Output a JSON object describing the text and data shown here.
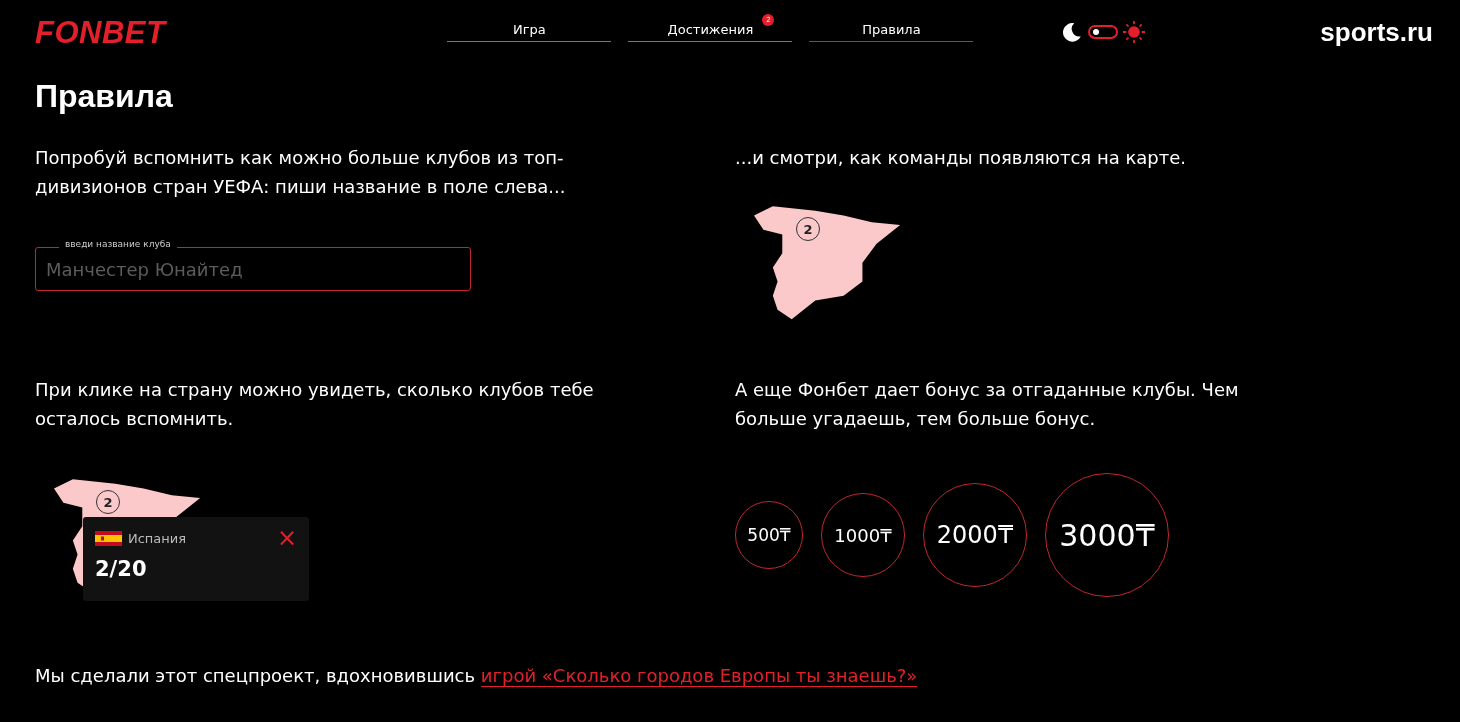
{
  "header": {
    "logo": "FONBET",
    "nav": [
      {
        "label": "Игра",
        "selected": false
      },
      {
        "label": "Достижения",
        "selected": false,
        "badge": "2"
      },
      {
        "label": "Правила",
        "selected": true
      }
    ],
    "theme_toggle": {
      "on": false
    },
    "partner_logo": "sports.ru"
  },
  "title": "Правила",
  "steps": [
    {
      "kind": "input",
      "text": "Попробуй вспомнить как можно больше клубов из топ-дивизионов стран УЕФА: пиши название в поле слева...",
      "field": {
        "label": "введи название клуба",
        "placeholder": "Манчестер Юнайтед"
      }
    },
    {
      "kind": "map",
      "text": "...и смотри, как команды появляются на карте.",
      "marker": "2"
    },
    {
      "kind": "popup",
      "text": "При клике на страну можно увидеть, сколько клубов тебе осталось вспомнить.",
      "marker": "2",
      "popup": {
        "country": "Испания",
        "score": "2/20",
        "close": "×"
      }
    },
    {
      "kind": "bonus",
      "text": "А еще Фонбет дает бонус за отгаданные клубы. Чем больше угадаешь, тем больше бонус.",
      "bonuses": [
        "500₸",
        "1000₸",
        "2000₸",
        "3000₸"
      ]
    }
  ],
  "footer": {
    "text": "Мы сделали этот спецпроект, вдохновившись ",
    "link": "игрой «Сколько городов Европы ты знаешь?»"
  }
}
